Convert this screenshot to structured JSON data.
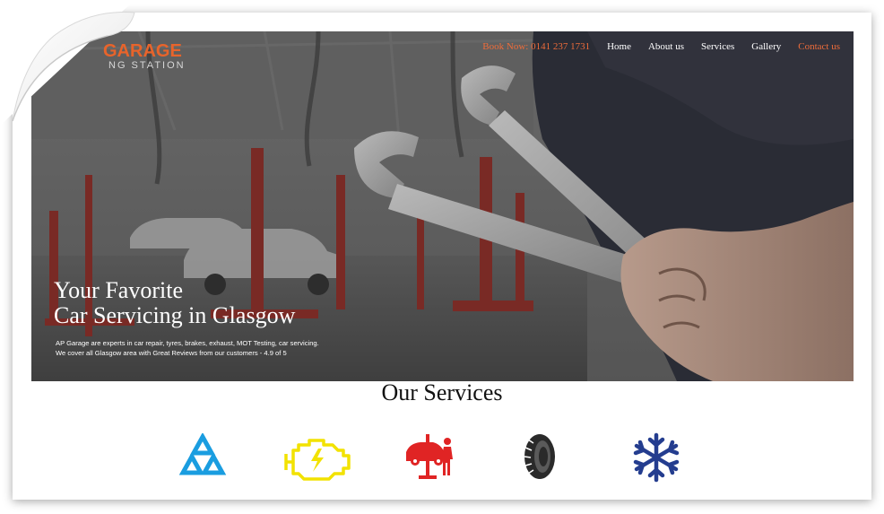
{
  "logo": {
    "main": "GARAGE",
    "sub": "NG STATION"
  },
  "nav": {
    "book": "Book Now: 0141 237 1731",
    "home": "Home",
    "about": "About us",
    "services": "Services",
    "gallery": "Gallery",
    "contact": "Contact us"
  },
  "hero": {
    "headline_line1": "Your Favorite",
    "headline_line2": "Car Servicing in Glasgow",
    "desc_line1": "AP Garage are experts in car repair, tyres, brakes, exhaust, MOT Testing, car servicing.",
    "desc_line2": "We cover all Glasgow area with Great Reviews from our customers - 4.9 of 5"
  },
  "services": {
    "title": "Our Services",
    "items": [
      {
        "icon": "mot-triangle-icon",
        "color": "#1a9de0"
      },
      {
        "icon": "engine-warning-icon",
        "color": "#f2e200"
      },
      {
        "icon": "car-lift-mechanic-icon",
        "color": "#e02424"
      },
      {
        "icon": "tyre-icon",
        "color": "#2a2a2a"
      },
      {
        "icon": "snowflake-aircon-icon",
        "color": "#243d8f"
      }
    ]
  },
  "colors": {
    "accent": "#e8642b",
    "hero_overlay": "#3b3a3a"
  }
}
